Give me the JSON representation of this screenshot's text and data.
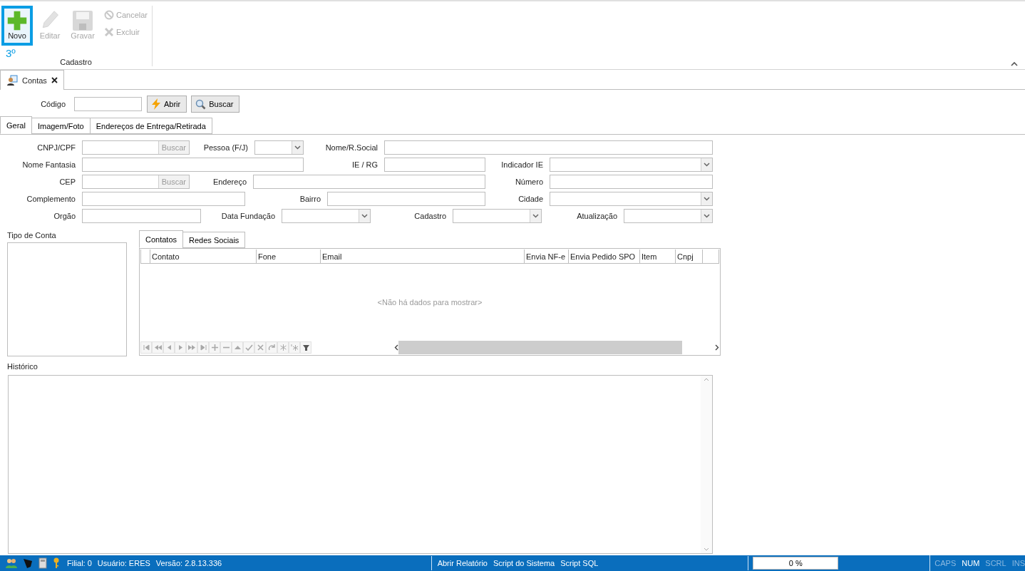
{
  "ribbon": {
    "buttons": [
      {
        "label": "Novo",
        "kind": "large",
        "disabled": false,
        "selected": true
      },
      {
        "label": "Editar",
        "kind": "large",
        "disabled": true,
        "selected": false
      },
      {
        "label": "Gravar",
        "kind": "large",
        "disabled": true,
        "selected": false
      },
      {
        "label": "Cancelar",
        "kind": "small",
        "disabled": true,
        "selected": false
      },
      {
        "label": "Excluir",
        "kind": "small",
        "disabled": true,
        "selected": false
      }
    ],
    "step_badge": "3º",
    "group_label": "Cadastro"
  },
  "document_tabs": [
    {
      "label": "Contas",
      "selected": true
    }
  ],
  "lookup": {
    "label": "Código",
    "buttons": [
      "Abrir",
      "Buscar"
    ]
  },
  "tabs": [
    {
      "label": "Geral",
      "selected": true
    },
    {
      "label": "Imagem/Foto",
      "selected": false
    },
    {
      "label": "Endereços de Entrega/Retirada",
      "selected": false
    }
  ],
  "form_rows": [
    [
      {
        "label": "CNPJ/CPF",
        "kind": "text-button",
        "button": "Buscar"
      },
      {
        "label": "Pessoa (F/J)",
        "kind": "combo"
      },
      {
        "label": "Nome/R.Social",
        "kind": "text"
      }
    ],
    [
      {
        "label": "Nome Fantasia",
        "kind": "text"
      },
      {
        "label": "IE / RG",
        "kind": "text"
      },
      {
        "label": "Indicador IE",
        "kind": "combo"
      }
    ],
    [
      {
        "label": "CEP",
        "kind": "text-button",
        "button": "Buscar"
      },
      {
        "label": "Endereço",
        "kind": "text"
      },
      {
        "label": "Número",
        "kind": "text"
      }
    ],
    [
      {
        "label": "Complemento",
        "kind": "text"
      },
      {
        "label": "Bairro",
        "kind": "text"
      },
      {
        "label": "Cidade",
        "kind": "combo"
      }
    ],
    [
      {
        "label": "Orgão",
        "kind": "text"
      },
      {
        "label": "Data Fundação",
        "kind": "combo"
      },
      {
        "label": "Cadastro",
        "kind": "combo"
      },
      {
        "label": "Atualização",
        "kind": "combo"
      }
    ]
  ],
  "account_type": {
    "label": "Tipo de Conta"
  },
  "contacts": {
    "tabs": [
      {
        "label": "Contatos",
        "selected": true
      },
      {
        "label": "Redes Sociais",
        "selected": false
      }
    ],
    "columns": [
      "Contato",
      "Fone",
      "Email",
      "Envia NF-e",
      "Envia Pedido SPO",
      "Item",
      "Cnpj"
    ],
    "empty_text": "<Não há dados para mostrar>"
  },
  "history": {
    "label": "Histórico"
  },
  "status_bar": {
    "info": [
      "Filial: 0",
      "Usuário: ERES",
      "Versão: 2.8.13.336"
    ],
    "links": [
      "Abrir Relatório",
      "Script do Sistema",
      "Script SQL"
    ],
    "progress": {
      "level": 0,
      "reading": "0 %"
    },
    "keys": [
      {
        "label": "CAPS",
        "on": false
      },
      {
        "label": "NUM",
        "on": true
      },
      {
        "label": "SCRL",
        "on": false
      },
      {
        "label": "INS",
        "on": false
      }
    ]
  }
}
